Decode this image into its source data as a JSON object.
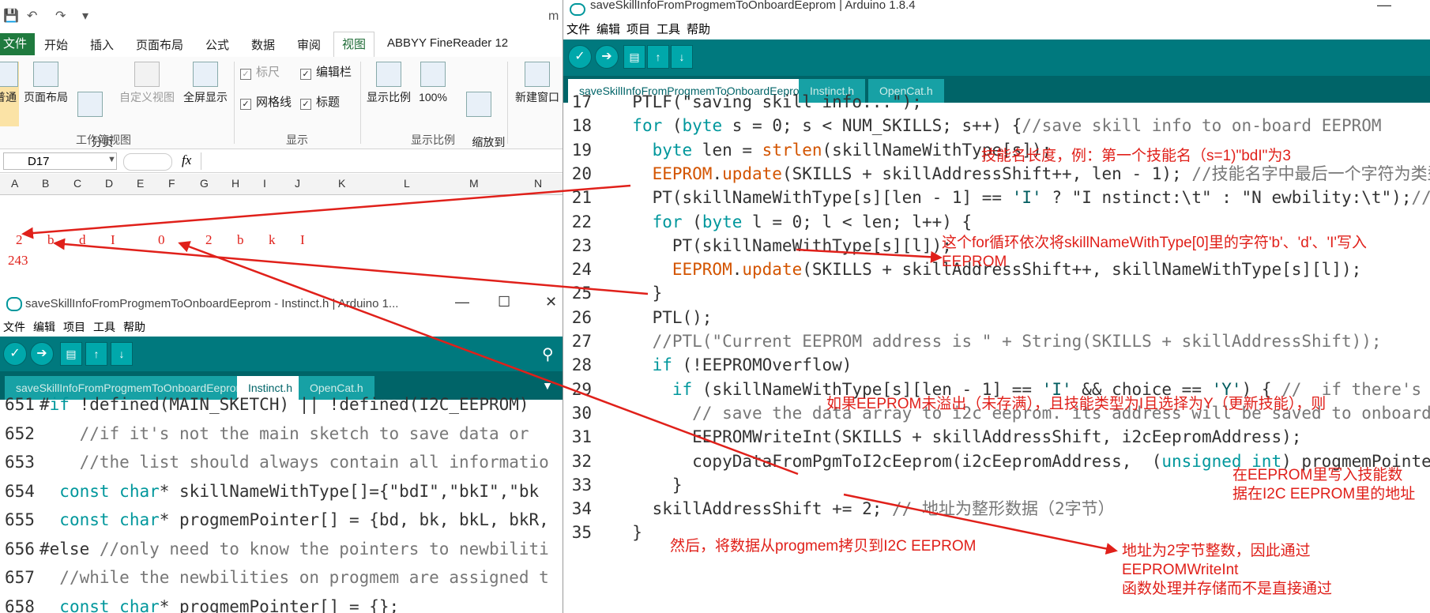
{
  "excel": {
    "title_partial": "m",
    "file_tab": "文件",
    "tabs": [
      "开始",
      "插入",
      "页面布局",
      "公式",
      "数据",
      "审阅",
      "视图",
      "ABBYY FineReader 12"
    ],
    "active_tab": "视图",
    "ribbon": {
      "workbook_views": {
        "normal": "普通",
        "page_layout": "页面布局",
        "page_break": "分页\n预览",
        "custom_view": "自定义视图",
        "full_screen": "全屏显示",
        "group": "工作簿视图"
      },
      "show": {
        "ruler": "标尺",
        "formula_bar": "编辑栏",
        "gridlines": "网格线",
        "headings": "标题",
        "group": "显示"
      },
      "zoom": {
        "zoom": "显示比例",
        "zoom100": "100%",
        "zoom_selection": "缩放到\n选定区域",
        "group": "显示比例"
      },
      "new_window": "新建窗口"
    },
    "name_box": "D17",
    "fx": "fx",
    "columns": [
      "A",
      "B",
      "C",
      "D",
      "E",
      "F",
      "G",
      "H",
      "I",
      "J",
      "K",
      "L",
      "M",
      "N"
    ],
    "row_values": [
      "2",
      "b",
      "d",
      "I",
      "0",
      "2",
      "b",
      "k",
      "I"
    ],
    "row2_value": "243"
  },
  "arduino_small": {
    "title": "saveSkillInfoFromProgmemToOnboardEeprom - Instinct.h | Arduino 1...",
    "menu": [
      "文件",
      "编辑",
      "项目",
      "工具",
      "帮助"
    ],
    "tabs": [
      "saveSkillInfoFromProgmemToOnboardEeprom",
      "Instinct.h",
      "OpenCat.h"
    ],
    "active_tab": "Instinct.h",
    "line_numbers": [
      "651",
      "652",
      "653",
      "654",
      "655",
      "656",
      "657",
      "658"
    ],
    "lines": [
      "#if !defined(MAIN_SKETCH) || !defined(I2C_EEPROM)",
      "    //if it's not the main sketch to save data or",
      "    //the list should always contain all informatio",
      "  const char* skillNameWithType[]={\"bdI\",\"bkI\",\"bk",
      "  const char* progmemPointer[] = {bd, bk, bkL, bkR,",
      "#else //only need to know the pointers to newbiliti",
      "  //while the newbilities on progmem are assigned t",
      "  const char* progmemPointer[] = {};"
    ]
  },
  "arduino_main": {
    "title": "saveSkillInfoFromProgmemToOnboardEeprom | Arduino 1.8.4",
    "menu": [
      "文件",
      "编辑",
      "项目",
      "工具",
      "帮助"
    ],
    "tabs": [
      "saveSkillInfoFromProgmemToOnboardEeprom §",
      "Instinct.h",
      "OpenCat.h"
    ],
    "active_tab": "saveSkillInfoFromProgmemToOnboardEeprom §",
    "lines": [
      {
        "n": "17",
        "t": "  PTLF(\"saving skill info...\");"
      },
      {
        "n": "18",
        "t": "  for (byte s = 0; s < NUM_SKILLS; s++) {//save skill info to on-board EEPROM"
      },
      {
        "n": "19",
        "t": "    byte len = strlen(skillNameWithType[s]);"
      },
      {
        "n": "20",
        "t": "    EEPROM.update(SKILLS + skillAddressShift++, len - 1); //技能名字中最后一个字符为类型,"
      },
      {
        "n": "21",
        "t": "    PT(skillNameWithType[s][len - 1] == 'I' ? \"I nstinct:\\t\" : \"N ewbility:\\t\");//如果类型"
      },
      {
        "n": "22",
        "t": "    for (byte l = 0; l < len; l++) {"
      },
      {
        "n": "23",
        "t": "      PT(skillNameWithType[s][l]);"
      },
      {
        "n": "24",
        "t": "      EEPROM.update(SKILLS + skillAddressShift++, skillNameWithType[s][l]);"
      },
      {
        "n": "25",
        "t": "    }"
      },
      {
        "n": "26",
        "t": "    PTL();"
      },
      {
        "n": "27",
        "t": "    //PTL(\"Current EEPROM address is \" + String(SKILLS + skillAddressShift));"
      },
      {
        "n": "28",
        "t": "    if (!EEPROMOverflow)"
      },
      {
        "n": "29",
        "t": "      if (skillNameWithType[s][len - 1] == 'I' && choice == 'Y') { //  if there's instinc"
      },
      {
        "n": "30",
        "t": "        // save the data array to i2c eeprom. its address will be saved to onboard eeprom"
      },
      {
        "n": "31",
        "t": "        EEPROMWriteInt(SKILLS + skillAddressShift, i2cEepromAddress);"
      },
      {
        "n": "32",
        "t": "        copyDataFromPgmToI2cEeprom(i2cEepromAddress,  (unsigned int) progmemPointer[s]);"
      },
      {
        "n": "33",
        "t": "      }"
      },
      {
        "n": "34",
        "t": "    skillAddressShift += 2; // 地址为整形数据（2字节）"
      },
      {
        "n": "35",
        "t": "  }"
      }
    ]
  },
  "annotations": {
    "a19": "技能名长度，例：第一个技能名（s=1)\"bdI\"为3",
    "a22": "这个for循环依次将skillNameWithType[0]里的字符'b'、'd'、'I'写入\nEEPROM",
    "a28": "如果EEPROM未溢出（未存满），且技能类型为I且选择为Y（更新技能），则",
    "a31": "在EEPROM里写入技能数\n据在I2C EEPROM里的地址",
    "a33": "然后，将数据从progmem拷贝到I2C EEPROM",
    "a34": "地址为2字节整数，因此通过\nEEPROMWriteInt\n函数处理并存储而不是直接通过"
  },
  "colors": {
    "annotation": "#e0201a",
    "arduino_teal": "#00797e",
    "arduino_dark": "#006468",
    "keyword": "#00979c",
    "function": "#d35400",
    "excel_green": "#1f7a3e"
  }
}
